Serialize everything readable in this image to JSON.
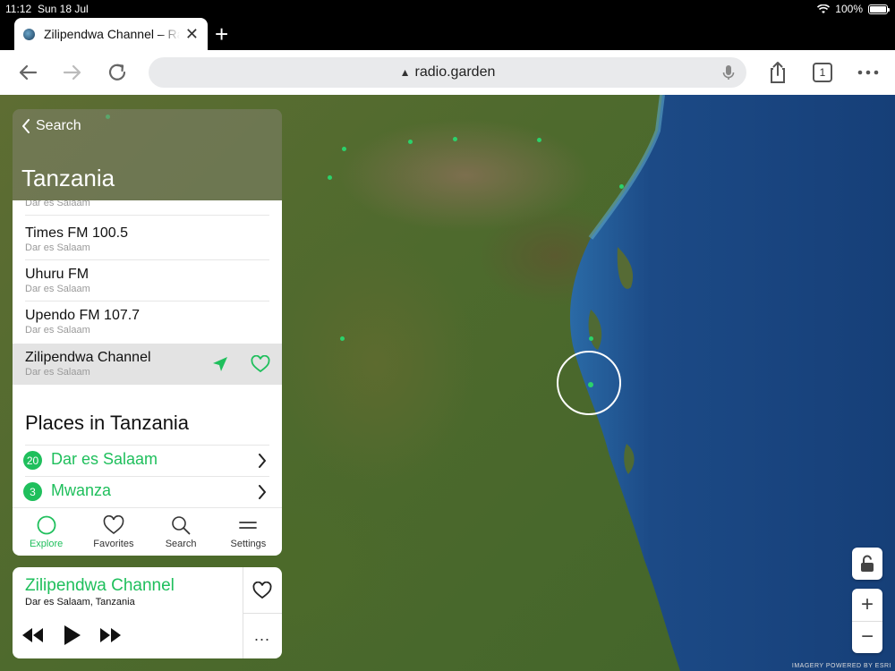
{
  "status": {
    "time": "11:12",
    "date": "Sun 18 Jul",
    "battery": "100%"
  },
  "browser": {
    "tab_title": "Zilipendwa Channel – Radio Garden",
    "url": "radio.garden",
    "tab_count": "1"
  },
  "panel": {
    "back_label": "Search",
    "country": "Tanzania",
    "stations": [
      {
        "name": "",
        "city": "Dar es Salaam"
      },
      {
        "name": "Times FM 100.5",
        "city": "Dar es Salaam"
      },
      {
        "name": "Uhuru FM",
        "city": "Dar es Salaam"
      },
      {
        "name": "Upendo FM 107.7",
        "city": "Dar es Salaam"
      },
      {
        "name": "Zilipendwa Channel",
        "city": "Dar es Salaam"
      }
    ],
    "places_title": "Places in Tanzania",
    "places": [
      {
        "count": "20",
        "name": "Dar es Salaam"
      },
      {
        "count": "3",
        "name": "Mwanza"
      }
    ]
  },
  "nav": {
    "explore": "Explore",
    "favorites": "Favorites",
    "search": "Search",
    "settings": "Settings"
  },
  "player": {
    "station": "Zilipendwa Channel",
    "location": "Dar es Salaam, Tanzania",
    "more": "..."
  },
  "map": {
    "attribution": "IMAGERY POWERED BY ESRI"
  },
  "colors": {
    "accent": "#1fbf5c",
    "station_dot": "#2bd26b",
    "sea": "#1c4a86"
  }
}
